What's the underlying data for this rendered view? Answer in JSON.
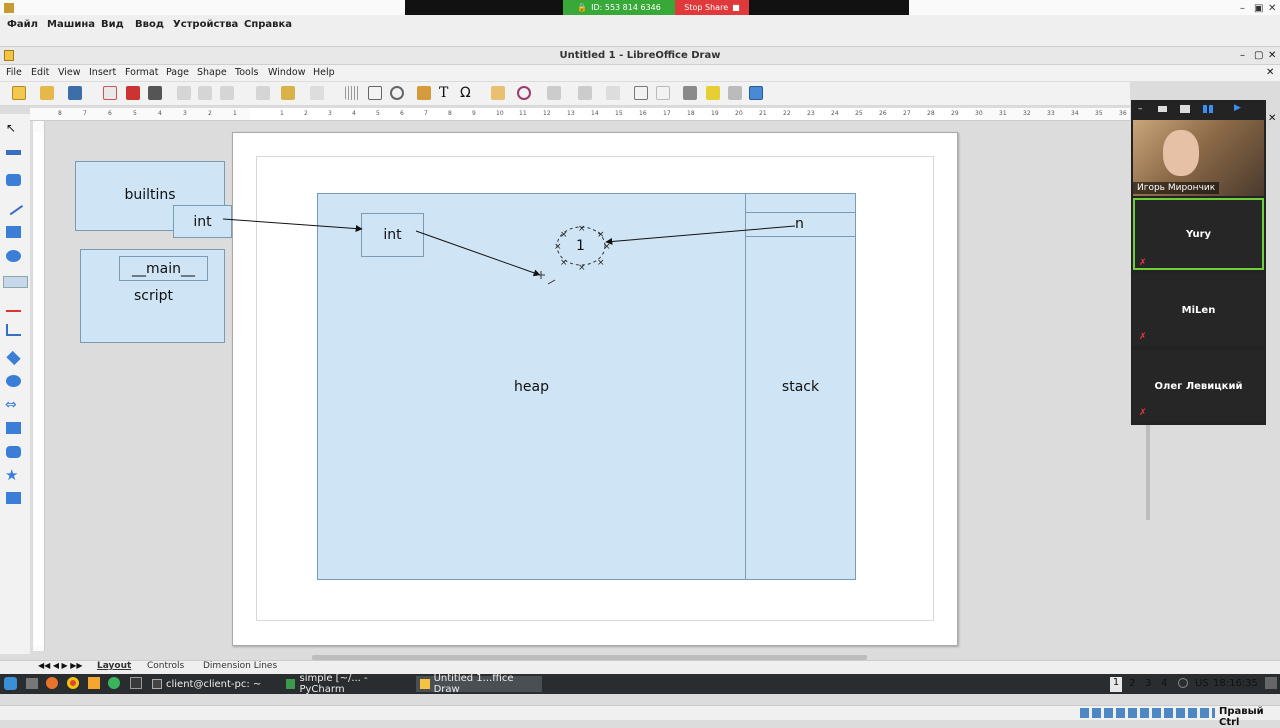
{
  "vm": {
    "menu": [
      "Файл",
      "Машина",
      "Вид",
      "Ввод",
      "Устройства",
      "Справка"
    ],
    "share_id": "ID: 553 814 6346",
    "stop_share": "Stop Share"
  },
  "window": {
    "title": "Untitled 1 - LibreOffice Draw"
  },
  "lo_menu": [
    "File",
    "Edit",
    "View",
    "Insert",
    "Format",
    "Page",
    "Shape",
    "Tools",
    "Window",
    "Help"
  ],
  "ruler_numbers": [
    "8",
    "7",
    "6",
    "5",
    "4",
    "3",
    "2",
    "1",
    "",
    "1",
    "2",
    "3",
    "4",
    "5",
    "6",
    "7",
    "8",
    "9",
    "10",
    "11",
    "12",
    "13",
    "14",
    "15",
    "16",
    "17",
    "18",
    "19",
    "20",
    "21",
    "22",
    "23",
    "24",
    "25",
    "26",
    "27",
    "28",
    "29",
    "30",
    "31",
    "32",
    "33",
    "34",
    "35",
    "36"
  ],
  "shapes": {
    "builtins": "builtins",
    "int_small": "int",
    "main_box": "__main__",
    "script": "script",
    "heap_int": "int",
    "one": "1",
    "n": "n",
    "heap": "heap",
    "stack": "stack"
  },
  "tabs": [
    "Layout",
    "Controls",
    "Dimension Lines"
  ],
  "taskbar": {
    "items": [
      "client@client-pc: ~",
      "simple [~/... - PyCharm",
      "Untitled 1...ffice Draw"
    ],
    "workspaces": [
      "1",
      "2",
      "3",
      "4"
    ],
    "locale": "US",
    "time": "18:16:35"
  },
  "tray_right": "Правый Ctrl",
  "zoom": {
    "self_name": "Игорь Мирончик",
    "participants": [
      "Yury",
      "MiLen",
      "Олег Левицкий"
    ]
  },
  "colors": {
    "shape_fill": "#cfe4f4",
    "shape_border": "#7a9bb4",
    "stop_red": "#e0393b",
    "share_green": "#38a838"
  }
}
